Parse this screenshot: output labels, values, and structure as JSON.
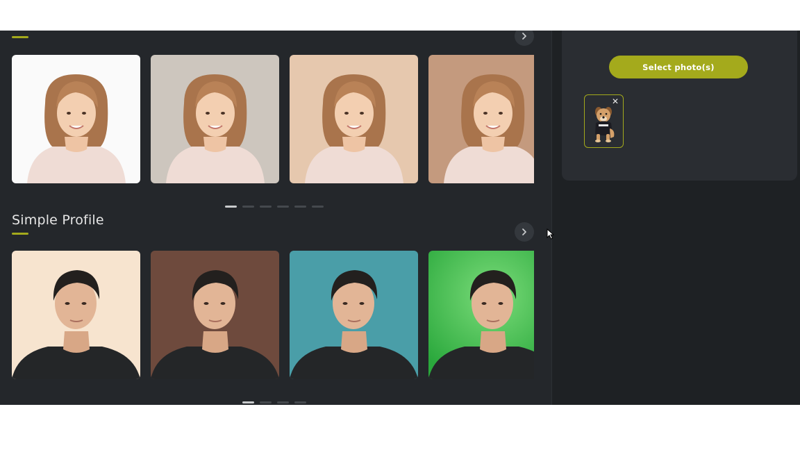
{
  "gallery": {
    "section1": {
      "title": "",
      "cards": [
        {
          "name": "white-background",
          "bg": "#fafafa"
        },
        {
          "name": "grey-background",
          "bg": "#cdc6be"
        },
        {
          "name": "beige-background",
          "bg": "#e6c8ae"
        },
        {
          "name": "tan-background",
          "bg": "#c49a7e"
        }
      ],
      "pager_pages": 6,
      "pager_active": 0
    },
    "section2": {
      "title": "Simple Profile",
      "cards": [
        {
          "name": "cream-background",
          "bg": "#f7e4cf"
        },
        {
          "name": "brown-background",
          "bg": "#6e4a3d"
        },
        {
          "name": "teal-background",
          "bg": "#4a9ea8"
        },
        {
          "name": "green-background",
          "bg": "#2aa83c"
        }
      ],
      "pager_pages": 4,
      "pager_active": 0
    }
  },
  "upload": {
    "select_label": "Select photo(s)",
    "uploaded_photo_subject": "dog",
    "remove_glyph": "✕"
  },
  "colors": {
    "accent": "#a4aa1c",
    "accent_border": "#8f951a",
    "app_bg": "#24272b",
    "panel_bg": "#2a2d32"
  },
  "icons": {
    "next": "chevron-right-icon",
    "remove": "close-icon",
    "cursor": "mouse-pointer-icon"
  }
}
